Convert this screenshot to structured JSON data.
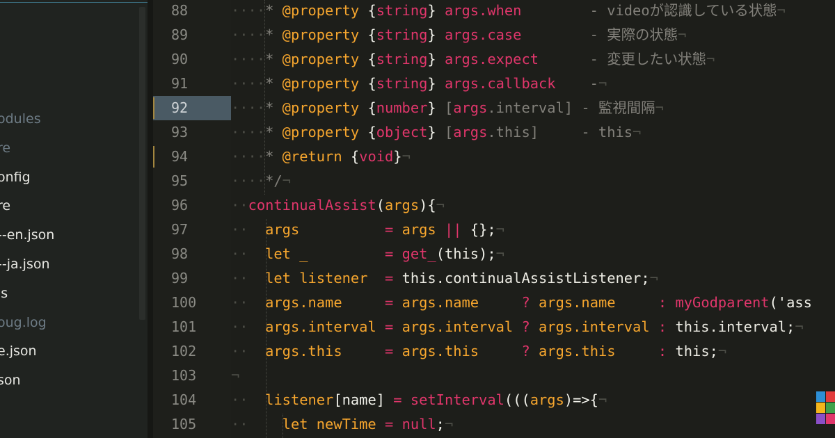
{
  "sidebar": {
    "items": [
      {
        "label": "odules",
        "dim": true
      },
      {
        "label": "re",
        "dim": true
      },
      {
        "label": "onfig",
        "dim": false
      },
      {
        "label": "re",
        "dim": false
      },
      {
        "label": "--en.json",
        "dim": false
      },
      {
        "label": "--ja.json",
        "dim": false
      },
      {
        "label": "js",
        "dim": false
      },
      {
        "label": "oug.log",
        "dim": true
      },
      {
        "label": "e.json",
        "dim": false
      },
      {
        "label": "son",
        "dim": false
      }
    ]
  },
  "gutter": {
    "lines": [
      "88",
      "89",
      "90",
      "91",
      "92",
      "93",
      "94",
      "95",
      "96",
      "97",
      "98",
      "99",
      "100",
      "101",
      "102",
      "103",
      "104",
      "105"
    ],
    "active_line": "92"
  },
  "code": {
    "lines": [
      [
        [
          "g",
          "····"
        ],
        [
          "c",
          "* "
        ],
        [
          "o",
          "@property "
        ],
        [
          "p",
          "{"
        ],
        [
          "t",
          "string"
        ],
        [
          "p",
          "} "
        ],
        [
          "t",
          "args.when"
        ],
        [
          "c",
          "        - videoが認識している状態"
        ],
        [
          "g",
          "¬"
        ]
      ],
      [
        [
          "g",
          "····"
        ],
        [
          "c",
          "* "
        ],
        [
          "o",
          "@property "
        ],
        [
          "p",
          "{"
        ],
        [
          "t",
          "string"
        ],
        [
          "p",
          "} "
        ],
        [
          "t",
          "args.case"
        ],
        [
          "c",
          "        - 実際の状態"
        ],
        [
          "g",
          "¬"
        ]
      ],
      [
        [
          "g",
          "····"
        ],
        [
          "c",
          "* "
        ],
        [
          "o",
          "@property "
        ],
        [
          "p",
          "{"
        ],
        [
          "t",
          "string"
        ],
        [
          "p",
          "} "
        ],
        [
          "t",
          "args.expect"
        ],
        [
          "c",
          "      - 変更したい状態"
        ],
        [
          "g",
          "¬"
        ]
      ],
      [
        [
          "g",
          "····"
        ],
        [
          "c",
          "* "
        ],
        [
          "o",
          "@property "
        ],
        [
          "p",
          "{"
        ],
        [
          "t",
          "string"
        ],
        [
          "p",
          "} "
        ],
        [
          "t",
          "args.callback"
        ],
        [
          "c",
          "    -"
        ],
        [
          "g",
          "¬"
        ]
      ],
      [
        [
          "g",
          "····"
        ],
        [
          "c",
          "* "
        ],
        [
          "o",
          "@property "
        ],
        [
          "p",
          "{"
        ],
        [
          "t",
          "number"
        ],
        [
          "p",
          "} "
        ],
        [
          "c",
          "["
        ],
        [
          "t",
          "args"
        ],
        [
          "c",
          ".interval] - 監視間隔"
        ],
        [
          "g",
          "¬"
        ]
      ],
      [
        [
          "g",
          "····"
        ],
        [
          "c",
          "* "
        ],
        [
          "o",
          "@property "
        ],
        [
          "p",
          "{"
        ],
        [
          "t",
          "object"
        ],
        [
          "p",
          "} "
        ],
        [
          "c",
          "["
        ],
        [
          "t",
          "args"
        ],
        [
          "c",
          ".this]     - this"
        ],
        [
          "g",
          "¬"
        ]
      ],
      [
        [
          "g",
          "····"
        ],
        [
          "c",
          "* "
        ],
        [
          "o",
          "@return "
        ],
        [
          "p",
          "{"
        ],
        [
          "t",
          "void"
        ],
        [
          "p",
          "}"
        ],
        [
          "g",
          "¬"
        ]
      ],
      [
        [
          "g",
          "····"
        ],
        [
          "c",
          "*/"
        ],
        [
          "g",
          "¬"
        ]
      ],
      [
        [
          "g",
          "··"
        ],
        [
          "t",
          "continualAssist"
        ],
        [
          "p",
          "("
        ],
        [
          "o",
          "args"
        ],
        [
          "p",
          "){"
        ],
        [
          "g",
          "¬"
        ]
      ],
      [
        [
          "g",
          "··"
        ],
        [
          "p",
          "  "
        ],
        [
          "k",
          "args"
        ],
        [
          "p",
          "          "
        ],
        [
          "t",
          "="
        ],
        [
          "p",
          " "
        ],
        [
          "k",
          "args"
        ],
        [
          "p",
          " "
        ],
        [
          "t",
          "||"
        ],
        [
          "p",
          " {};"
        ],
        [
          "g",
          "¬"
        ]
      ],
      [
        [
          "g",
          "··"
        ],
        [
          "p",
          "  "
        ],
        [
          "k",
          "let _"
        ],
        [
          "p",
          "         "
        ],
        [
          "t",
          "="
        ],
        [
          "p",
          " "
        ],
        [
          "t",
          "get_"
        ],
        [
          "p",
          "("
        ],
        [
          "cv",
          "this"
        ],
        [
          "p",
          ");"
        ],
        [
          "g",
          "¬"
        ]
      ],
      [
        [
          "g",
          "··"
        ],
        [
          "p",
          "  "
        ],
        [
          "k",
          "let listener"
        ],
        [
          "p",
          "  "
        ],
        [
          "t",
          "="
        ],
        [
          "p",
          " "
        ],
        [
          "cv",
          "this.continualAssistListener"
        ],
        [
          "p",
          ";"
        ],
        [
          "g",
          "¬"
        ]
      ],
      [
        [
          "g",
          "··"
        ],
        [
          "p",
          "  "
        ],
        [
          "k",
          "args.name"
        ],
        [
          "p",
          "     "
        ],
        [
          "t",
          "="
        ],
        [
          "p",
          " "
        ],
        [
          "k",
          "args.name"
        ],
        [
          "p",
          "     "
        ],
        [
          "t",
          "?"
        ],
        [
          "p",
          " "
        ],
        [
          "k",
          "args.name"
        ],
        [
          "p",
          "     "
        ],
        [
          "t",
          ":"
        ],
        [
          "p",
          " "
        ],
        [
          "t",
          "myGodparent"
        ],
        [
          "p",
          "('ass"
        ]
      ],
      [
        [
          "g",
          "··"
        ],
        [
          "p",
          "  "
        ],
        [
          "k",
          "args.interval"
        ],
        [
          "p",
          " "
        ],
        [
          "t",
          "="
        ],
        [
          "p",
          " "
        ],
        [
          "k",
          "args.interval"
        ],
        [
          "p",
          " "
        ],
        [
          "t",
          "?"
        ],
        [
          "p",
          " "
        ],
        [
          "k",
          "args.interval"
        ],
        [
          "p",
          " "
        ],
        [
          "t",
          ":"
        ],
        [
          "p",
          " "
        ],
        [
          "cv",
          "this.interval"
        ],
        [
          "p",
          ";"
        ],
        [
          "g",
          "¬"
        ]
      ],
      [
        [
          "g",
          "··"
        ],
        [
          "p",
          "  "
        ],
        [
          "k",
          "args.this"
        ],
        [
          "p",
          "     "
        ],
        [
          "t",
          "="
        ],
        [
          "p",
          " "
        ],
        [
          "k",
          "args.this"
        ],
        [
          "p",
          "     "
        ],
        [
          "t",
          "?"
        ],
        [
          "p",
          " "
        ],
        [
          "k",
          "args.this"
        ],
        [
          "p",
          "     "
        ],
        [
          "t",
          ":"
        ],
        [
          "p",
          " "
        ],
        [
          "cv",
          "this"
        ],
        [
          "p",
          ";"
        ],
        [
          "g",
          "¬"
        ]
      ],
      [
        [
          "g",
          "¬"
        ]
      ],
      [
        [
          "g",
          "··"
        ],
        [
          "p",
          "  "
        ],
        [
          "k",
          "listener"
        ],
        [
          "p",
          "[name] "
        ],
        [
          "t",
          "="
        ],
        [
          "p",
          " "
        ],
        [
          "t",
          "setInterval"
        ],
        [
          "p",
          "((("
        ],
        [
          "o",
          "args"
        ],
        [
          "p",
          ")=>{"
        ],
        [
          "g",
          "¬"
        ]
      ],
      [
        [
          "g",
          "··"
        ],
        [
          "p",
          "    "
        ],
        [
          "k",
          "let newTime"
        ],
        [
          "p",
          " "
        ],
        [
          "t",
          "="
        ],
        [
          "p",
          " "
        ],
        [
          "t",
          "null"
        ],
        [
          "p",
          ";"
        ],
        [
          "g",
          "¬"
        ]
      ]
    ]
  },
  "colors": {
    "background": "#1d1e1a",
    "keyword": "#e0366b",
    "identifier": "#f6a62e",
    "comment": "#82807a",
    "active_line": "#4a5a64"
  }
}
